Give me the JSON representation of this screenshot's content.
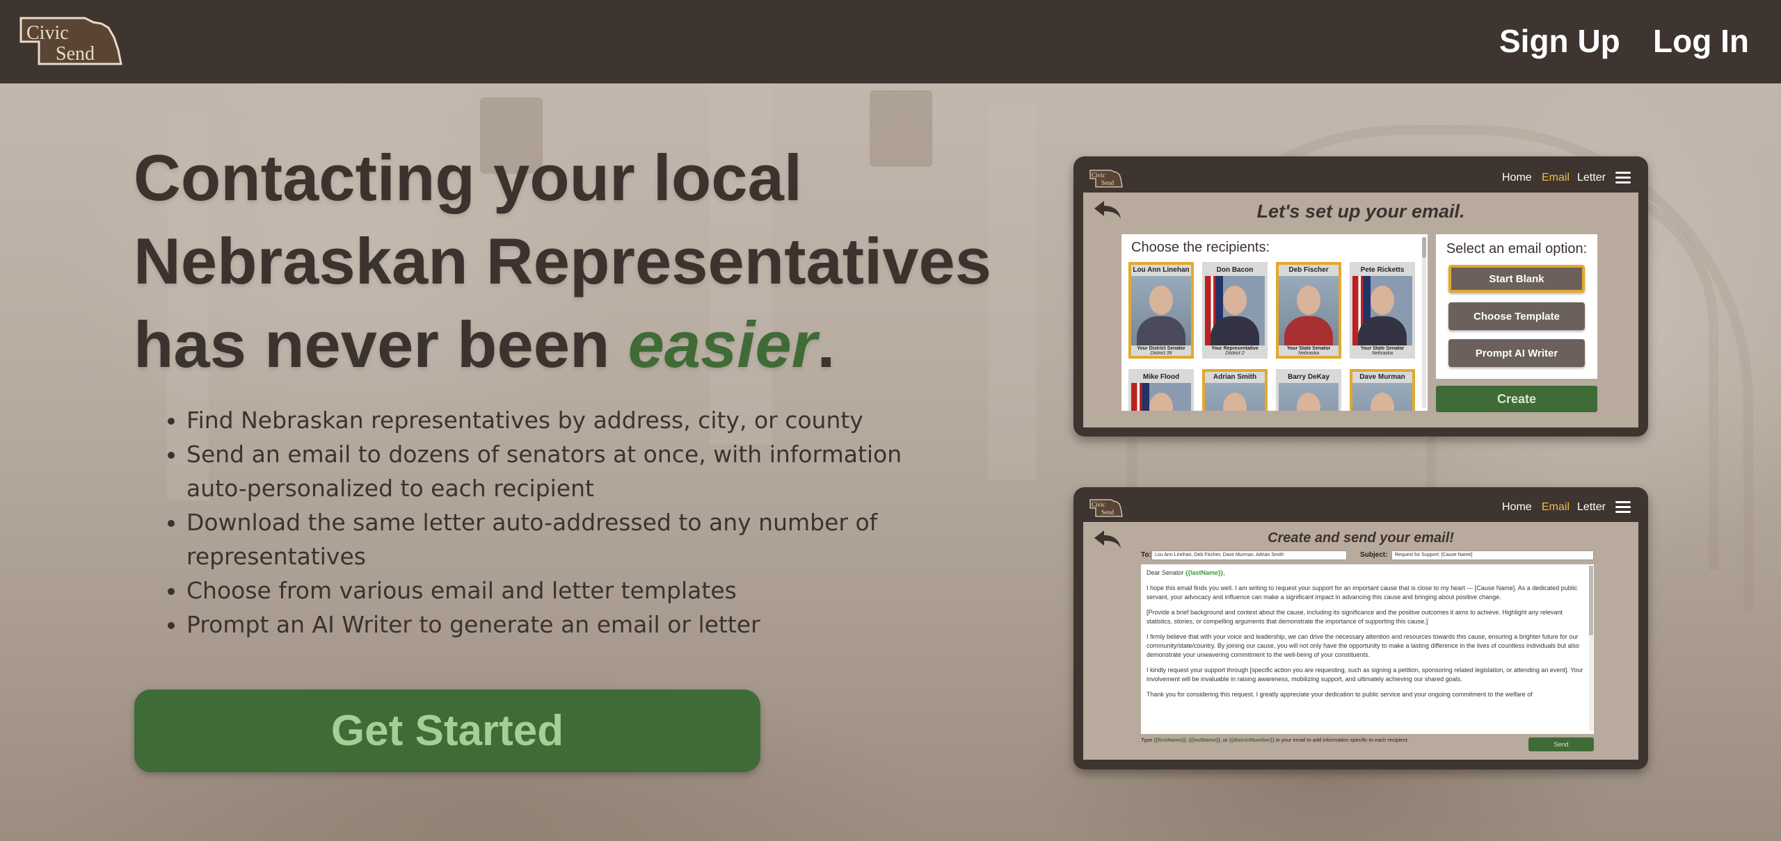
{
  "header": {
    "logo_text": "Civic Send",
    "nav": {
      "signup": "Sign Up",
      "login": "Log In"
    }
  },
  "hero": {
    "title_part1": "Contacting your local",
    "title_part2": "Nebraskan Representatives",
    "title_part3": "has never been ",
    "title_accent": "easier",
    "title_end": ".",
    "features": [
      "Find Nebraskan representatives by address, city, or county",
      "Send an email to dozens of senators at once, with information auto-personalized to each recipient",
      "Download the same letter auto-addressed to any number of representatives",
      "Choose from various email and letter templates",
      "Prompt an AI Writer to generate an email or letter"
    ],
    "cta": "Get Started"
  },
  "colors": {
    "header_bg": "#3e3430",
    "accent_green": "#3f6b36",
    "cta_text": "#a5cf94",
    "highlight_gold": "#e3a92c",
    "active_nav": "#f0c040"
  },
  "mock_setup": {
    "nav": {
      "home": "Home",
      "email": "Email",
      "letter": "Letter"
    },
    "title": "Let's set up your email.",
    "recipients_heading": "Choose the recipients:",
    "recipients": [
      {
        "name": "Lou Ann Linehan",
        "role": "Your District Senator",
        "district": "District 39",
        "selected": true
      },
      {
        "name": "Don Bacon",
        "role": "Your Representative",
        "district": "District 2",
        "selected": false
      },
      {
        "name": "Deb Fischer",
        "role": "Your State Senator",
        "district": "Nebraska",
        "selected": true
      },
      {
        "name": "Pete Ricketts",
        "role": "Your State Senator",
        "district": "Nebraska",
        "selected": false
      },
      {
        "name": "Mike Flood",
        "role": "",
        "district": "",
        "selected": false
      },
      {
        "name": "Adrian Smith",
        "role": "",
        "district": "",
        "selected": true
      },
      {
        "name": "Barry DeKay",
        "role": "",
        "district": "",
        "selected": false
      },
      {
        "name": "Dave Murman",
        "role": "",
        "district": "",
        "selected": true
      }
    ],
    "options_heading": "Select an email option:",
    "options": [
      "Start Blank",
      "Choose Template",
      "Prompt AI Writer"
    ],
    "selected_option": "Start Blank",
    "create": "Create"
  },
  "mock_compose": {
    "nav": {
      "home": "Home",
      "email": "Email",
      "letter": "Letter"
    },
    "title": "Create and send your email!",
    "to_label": "To:",
    "to_value": "Lou Ann Linehan, Deb Fischer, Dave Murman, Adrian Smith",
    "subject_label": "Subject:",
    "subject_value": "Request for Support: [Cause Name]",
    "greeting": "Dear Senator ",
    "greeting_var": "{{lastName}}",
    "greeting_end": ",",
    "paragraphs": [
      "I hope this email finds you well. I am writing to request your support for an important cause that is close to my heart — [Cause Name]. As a dedicated public servant, your advocacy and influence can make a significant impact in advancing this cause and bringing about positive change.",
      "[Provide a brief background and context about the cause, including its significance and the positive outcomes it aims to achieve. Highlight any relevant statistics, stories, or compelling arguments that demonstrate the importance of supporting this cause.]",
      "I firmly believe that with your voice and leadership, we can drive the necessary attention and resources towards this cause, ensuring a brighter future for our community/state/country. By joining our cause, you will not only have the opportunity to make a lasting difference in the lives of countless individuals but also demonstrate your unwavering commitment to the well-being of your constituents.",
      "I kindly request your support through [specific action you are requesting, such as signing a petition, sponsoring related legislation, or attending an event]. Your involvement will be invaluable in raising awareness, mobilizing support, and ultimately achieving our shared goals.",
      "Thank you for considering this request. I greatly appreciate your dedication to public service and your ongoing commitment to the welfare of"
    ],
    "hint_prefix": "Type ",
    "hint_var1": "{{firstName}}",
    "hint_sep1": ", ",
    "hint_var2": "{{lastName}}",
    "hint_sep2": ", or ",
    "hint_var3": "{{districtNumber}}",
    "hint_suffix": " in your email to add information specific to each recipient.",
    "send": "Send"
  }
}
